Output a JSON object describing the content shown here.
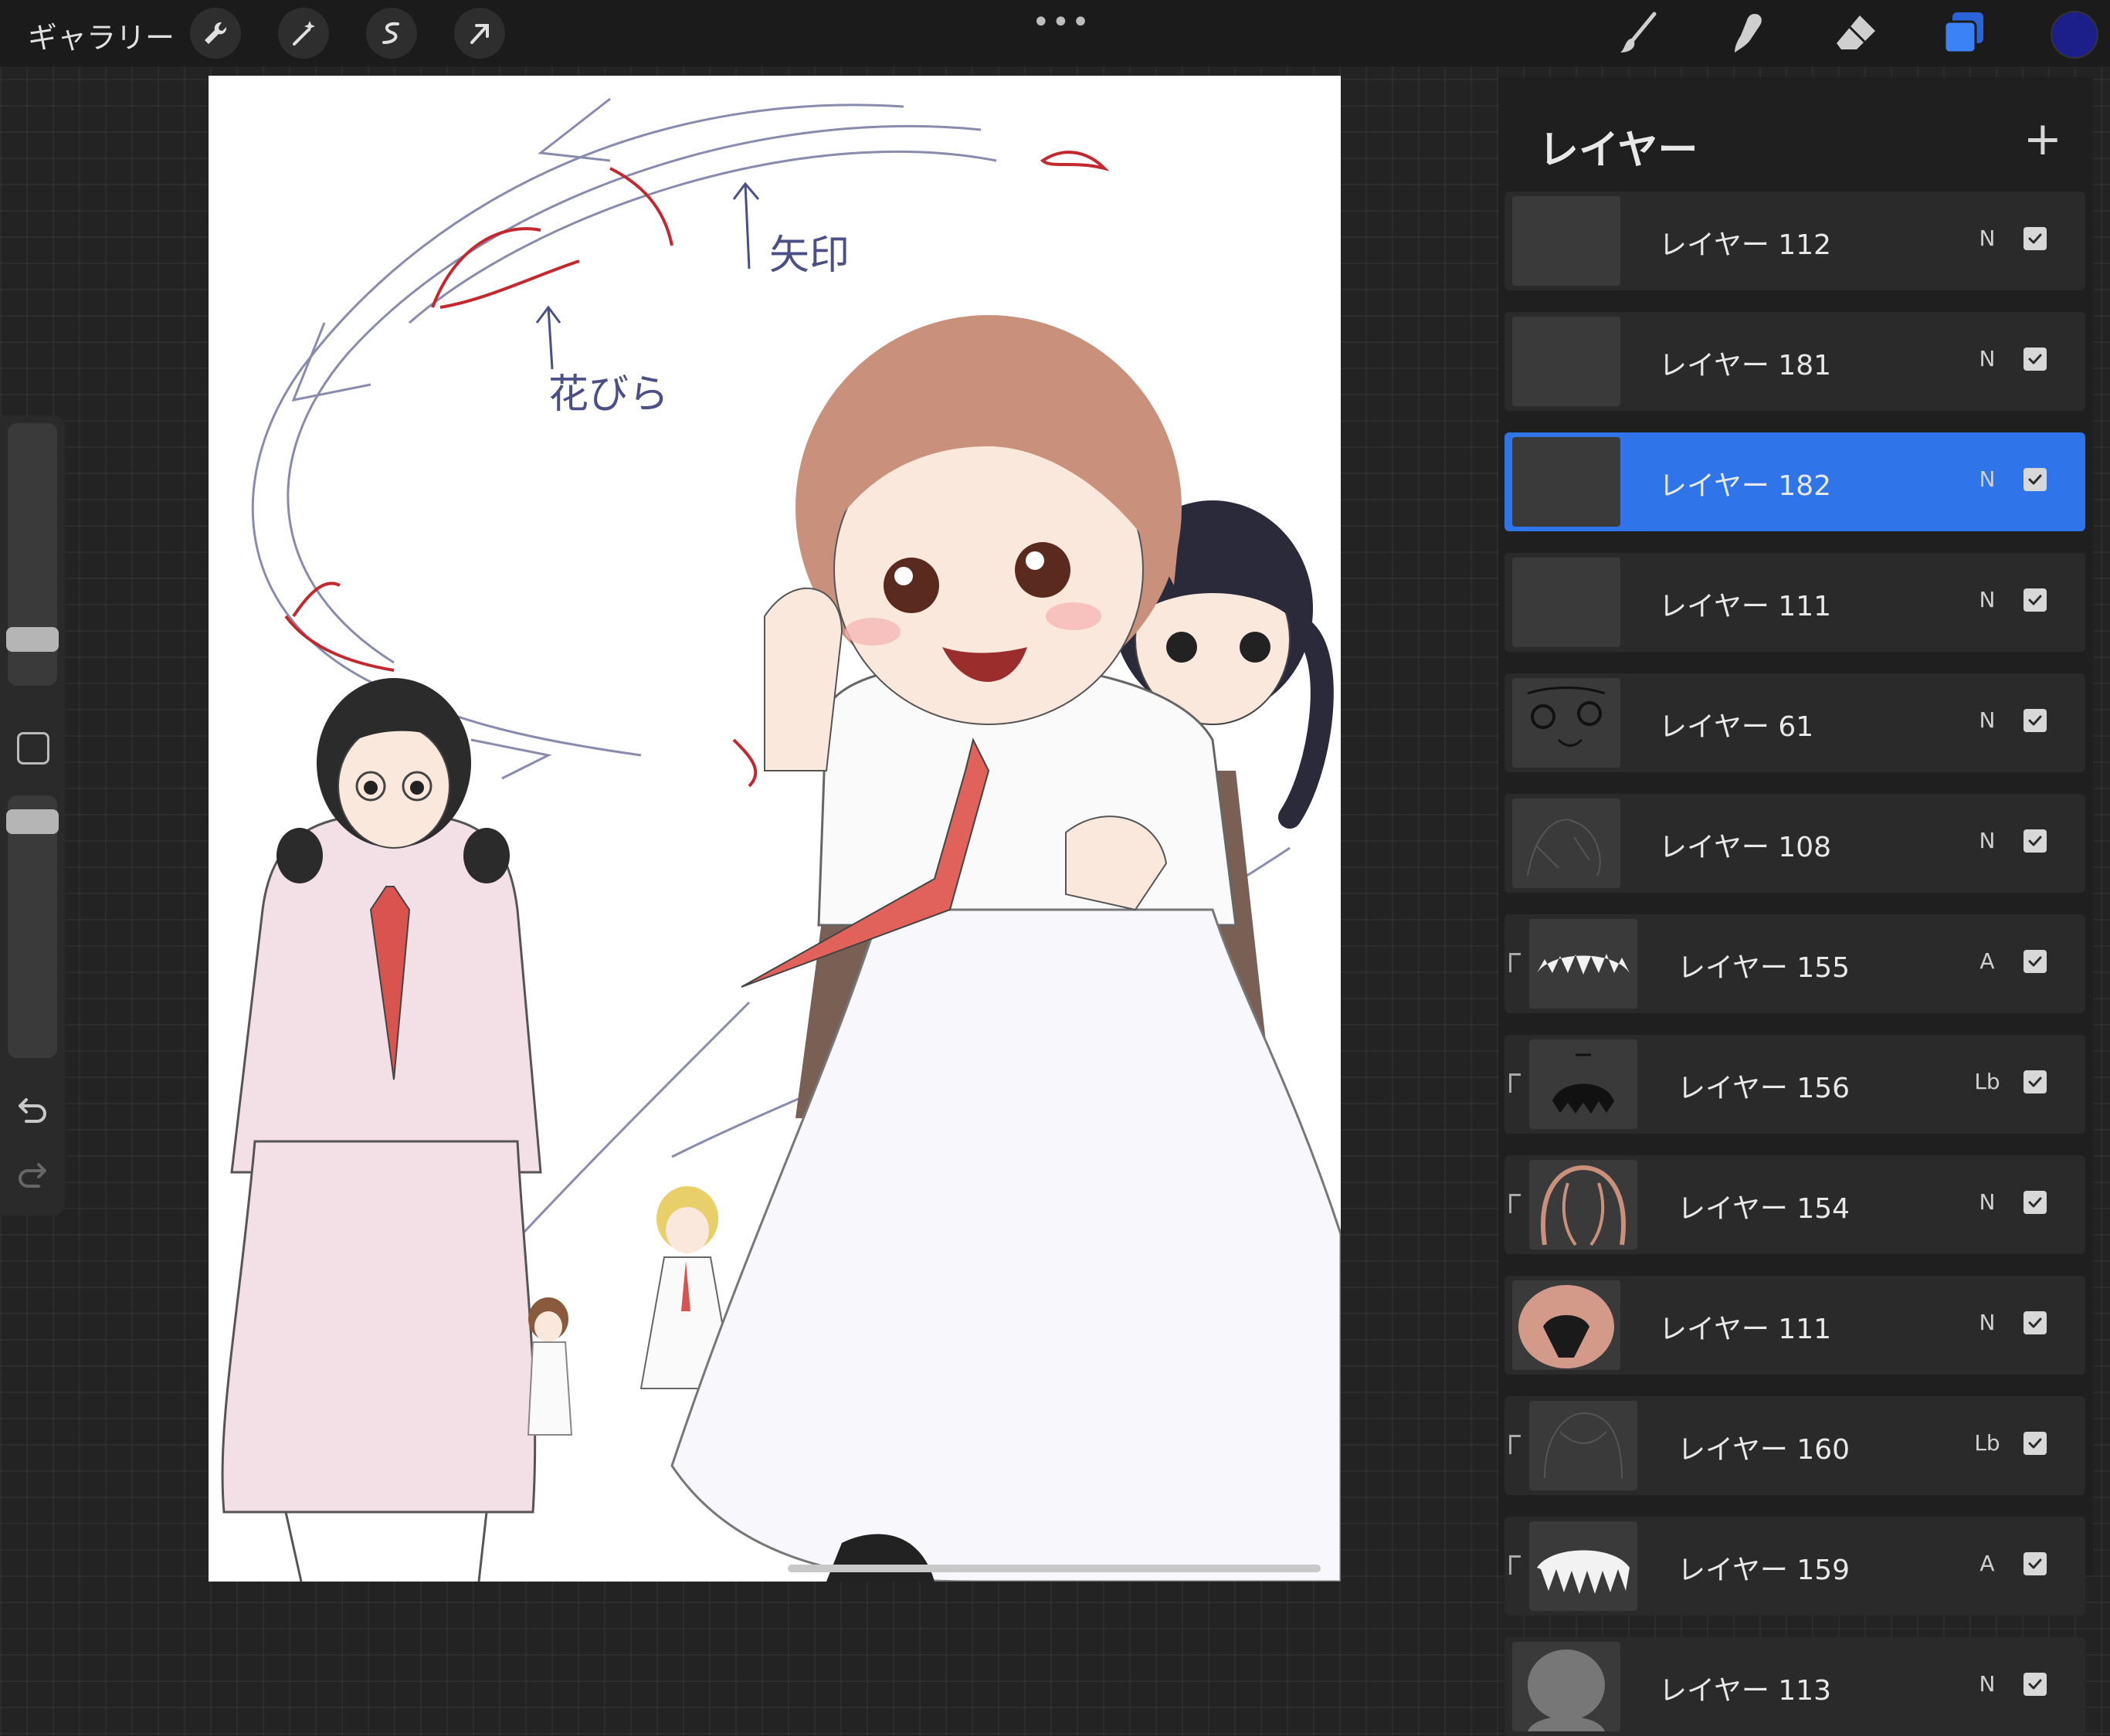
{
  "topbar": {
    "gallery_label": "ギャラリー",
    "tools_left": [
      "wrench-icon",
      "magic-wand-icon",
      "selection-icon",
      "transform-arrow-icon"
    ],
    "more": "•••",
    "tools_right": [
      "brush-icon",
      "smudge-icon",
      "eraser-icon",
      "layers-icon"
    ],
    "current_color": "#1c1f8a"
  },
  "canvas": {
    "annotations": [
      "矢印",
      "花びら"
    ]
  },
  "layers_panel": {
    "title": "レイヤー",
    "add_symbol": "+",
    "layers": [
      {
        "name": "レイヤー 112",
        "blend": "N",
        "clipped": false,
        "selected": false
      },
      {
        "name": "レイヤー 181",
        "blend": "N",
        "clipped": false,
        "selected": false
      },
      {
        "name": "レイヤー 182",
        "blend": "N",
        "clipped": false,
        "selected": true
      },
      {
        "name": "レイヤー 111",
        "blend": "N",
        "clipped": false,
        "selected": false
      },
      {
        "name": "レイヤー 61",
        "blend": "N",
        "clipped": false,
        "selected": false
      },
      {
        "name": "レイヤー 108",
        "blend": "N",
        "clipped": false,
        "selected": false
      },
      {
        "name": "レイヤー 155",
        "blend": "A",
        "clipped": true,
        "selected": false
      },
      {
        "name": "レイヤー 156",
        "blend": "Lb",
        "clipped": true,
        "selected": false
      },
      {
        "name": "レイヤー 154",
        "blend": "N",
        "clipped": true,
        "selected": false
      },
      {
        "name": "レイヤー 111",
        "blend": "N",
        "clipped": false,
        "selected": false
      },
      {
        "name": "レイヤー 160",
        "blend": "Lb",
        "clipped": true,
        "selected": false
      },
      {
        "name": "レイヤー 159",
        "blend": "A",
        "clipped": true,
        "selected": false
      },
      {
        "name": "レイヤー 113",
        "blend": "N",
        "clipped": false,
        "selected": false
      }
    ]
  }
}
